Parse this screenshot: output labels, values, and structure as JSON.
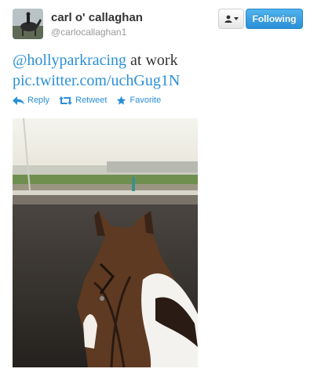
{
  "tweet": {
    "author": {
      "fullname": "carl o' callaghan",
      "username": "@carlocallaghan1"
    },
    "follow_button_label": "Following",
    "text": {
      "mention": "@hollyparkracing",
      "body": " at work",
      "link": "pic.twitter.com/uchGug1N"
    },
    "actions": [
      {
        "label": "Reply",
        "icon": "reply-icon"
      },
      {
        "label": "Retweet",
        "icon": "retweet-icon"
      },
      {
        "label": "Favorite",
        "icon": "star-icon"
      }
    ]
  },
  "colors": {
    "link": "#2a8fd6",
    "follow_button": "#2a8fd6",
    "text": "#333333",
    "muted": "#999999"
  }
}
